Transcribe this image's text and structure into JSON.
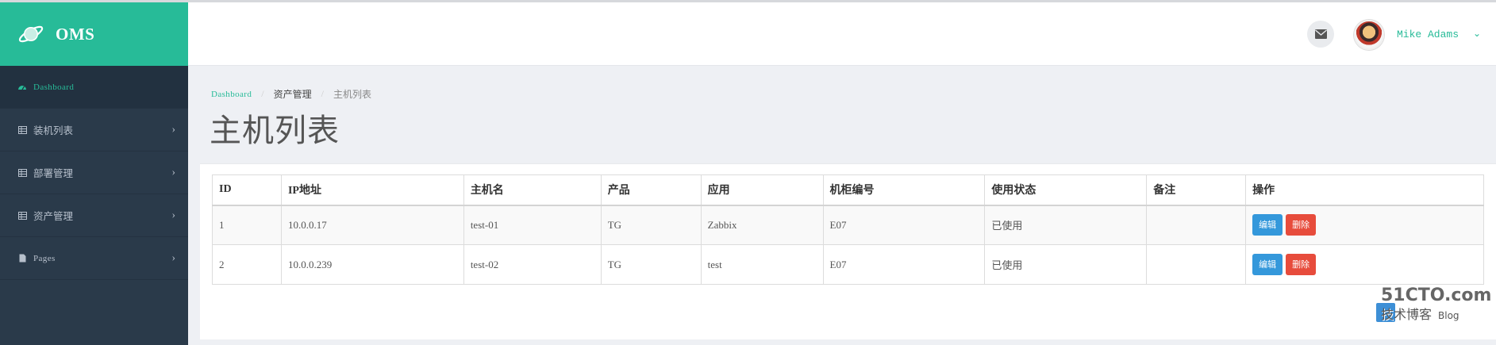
{
  "brand": {
    "name": "OMS"
  },
  "sidebar": {
    "items": [
      {
        "label": "Dashboard",
        "icon": "dashboard-icon",
        "active": true
      },
      {
        "label": "装机列表",
        "icon": "table-icon"
      },
      {
        "label": "部署管理",
        "icon": "table-icon"
      },
      {
        "label": "资产管理",
        "icon": "table-icon"
      },
      {
        "label": "Pages",
        "icon": "file-icon"
      }
    ]
  },
  "header": {
    "user_name": "Mike Adams"
  },
  "breadcrumb": [
    "Dashboard",
    "资产管理",
    "主机列表"
  ],
  "page_title": "主机列表",
  "table": {
    "headers": [
      "ID",
      "IP地址",
      "主机名",
      "产品",
      "应用",
      "机柜编号",
      "使用状态",
      "备注",
      "操作"
    ],
    "rows": [
      {
        "id": "1",
        "ip": "10.0.0.17",
        "hostname": "test-01",
        "product": "TG",
        "app": "Zabbix",
        "cabinet": "E07",
        "status": "已使用",
        "remark": ""
      },
      {
        "id": "2",
        "ip": "10.0.0.239",
        "hostname": "test-02",
        "product": "TG",
        "app": "test",
        "cabinet": "E07",
        "status": "已使用",
        "remark": ""
      }
    ],
    "edit_label": "编辑",
    "delete_label": "删除"
  },
  "watermark": {
    "line1": "51CTO.com",
    "line2": "技术博客",
    "line3": "Blog"
  },
  "colors": {
    "accent": "#27bb98",
    "sidebar": "#2a3a4a",
    "edit": "#3498db",
    "delete": "#e74c3c"
  }
}
